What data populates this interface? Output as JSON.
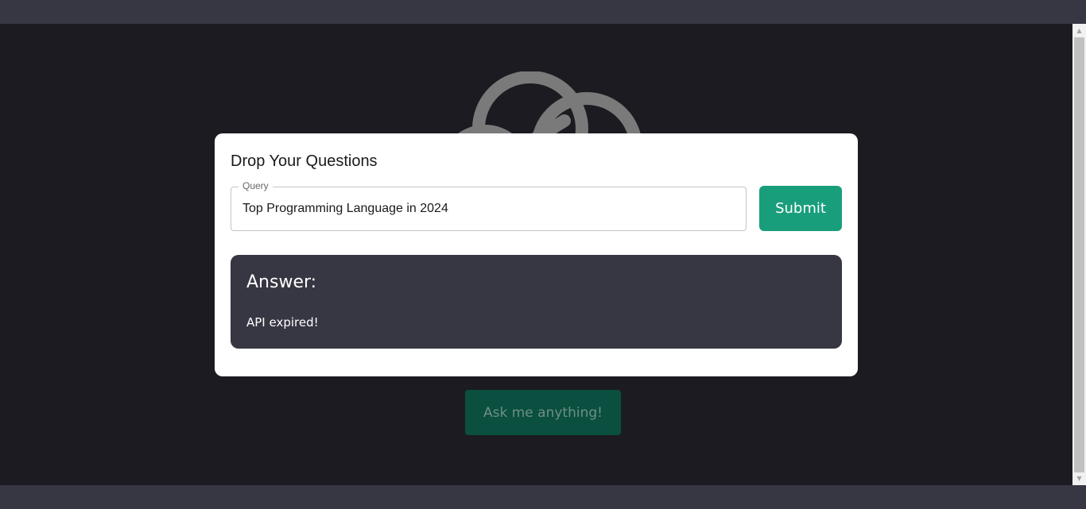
{
  "background_page": {
    "ask_button_label": "Ask me anything!"
  },
  "dialog": {
    "title": "Drop Your Questions",
    "query": {
      "label": "Query",
      "value": "Top Programming Language in 2024"
    },
    "submit_label": "Submit",
    "answer": {
      "heading": "Answer:",
      "text": "API expired!"
    }
  },
  "colors": {
    "page_background": "#1c1b21",
    "bars": "#373643",
    "accent": "#199e7b",
    "answer_panel": "#373643"
  },
  "icons": {
    "logo": "brain-cloud-logo-icon",
    "scroll_up": "scroll-up-arrow-icon",
    "scroll_down": "scroll-down-arrow-icon"
  }
}
